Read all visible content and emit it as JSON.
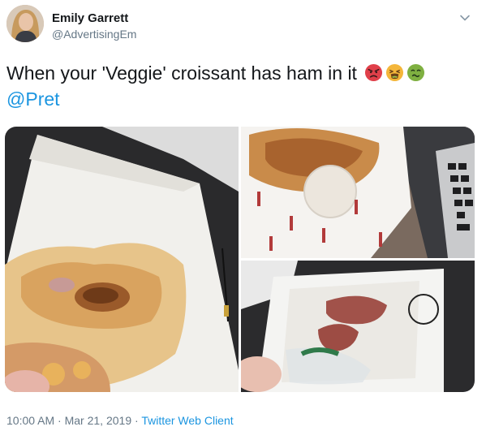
{
  "user": {
    "display_name": "Emily Garrett",
    "handle": "@AdvertisingEm"
  },
  "tweet": {
    "text": "When your 'Veggie' croissant has ham in it",
    "emojis": [
      "pouting-face-emoji",
      "tired-face-emoji",
      "nauseated-face-emoji"
    ],
    "mention": "@Pret"
  },
  "meta": {
    "time": "10:00 AM",
    "separator1": " · ",
    "date": "Mar 21, 2019",
    "separator2": " · ",
    "client": "Twitter Web Client"
  },
  "colors": {
    "link": "#1b95e0",
    "secondary_text": "#657786",
    "primary_text": "#14171a"
  }
}
